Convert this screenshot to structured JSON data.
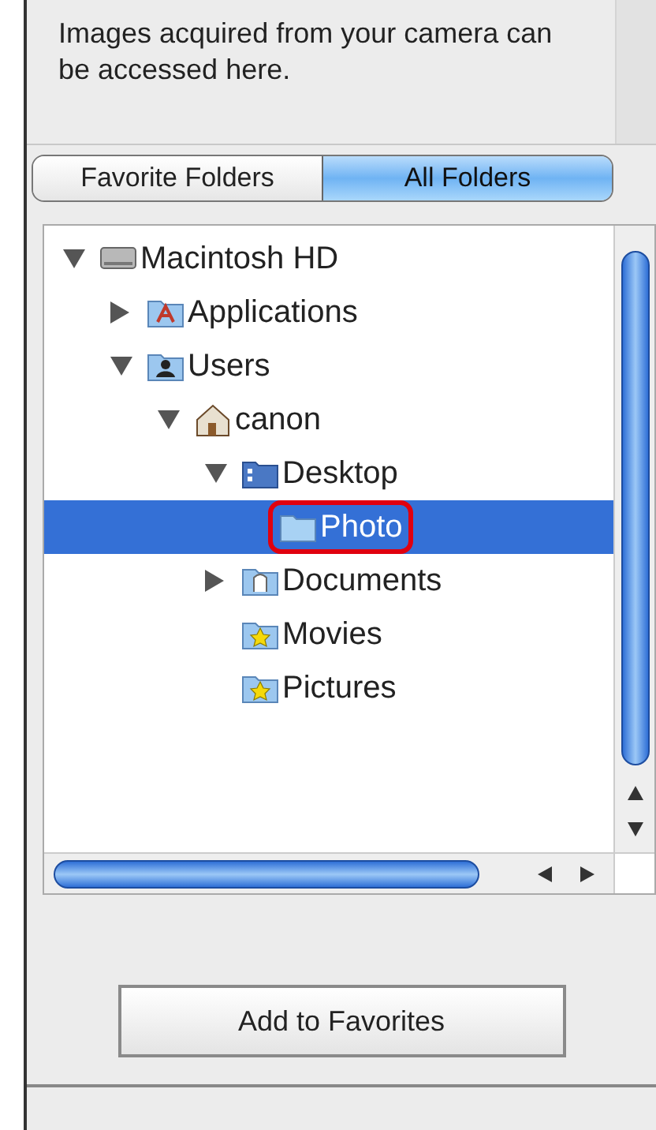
{
  "info_text": "Images acquired from your camera can be accessed here.",
  "tabs": [
    {
      "label": "Favorite Folders",
      "selected": false
    },
    {
      "label": "All Folders",
      "selected": true
    }
  ],
  "tree": [
    {
      "label": "Macintosh HD",
      "kind": "drive",
      "expanded": true,
      "selected": false,
      "children": [
        {
          "label": "Applications",
          "kind": "applications",
          "expanded": false,
          "selected": false
        },
        {
          "label": "Users",
          "kind": "users",
          "expanded": true,
          "selected": false,
          "children": [
            {
              "label": "canon",
              "kind": "home",
              "expanded": true,
              "selected": false,
              "children": [
                {
                  "label": "Desktop",
                  "kind": "desktop",
                  "expanded": true,
                  "selected": false,
                  "children": [
                    {
                      "label": "Photo",
                      "kind": "folder",
                      "selected": true,
                      "circled": true
                    }
                  ]
                },
                {
                  "label": "Documents",
                  "kind": "documents",
                  "expanded": false,
                  "selected": false
                },
                {
                  "label": "Movies",
                  "kind": "starred",
                  "selected": false
                },
                {
                  "label": "Pictures",
                  "kind": "starred",
                  "selected": false
                }
              ]
            }
          ]
        }
      ]
    }
  ],
  "button": "Add to Favorites"
}
